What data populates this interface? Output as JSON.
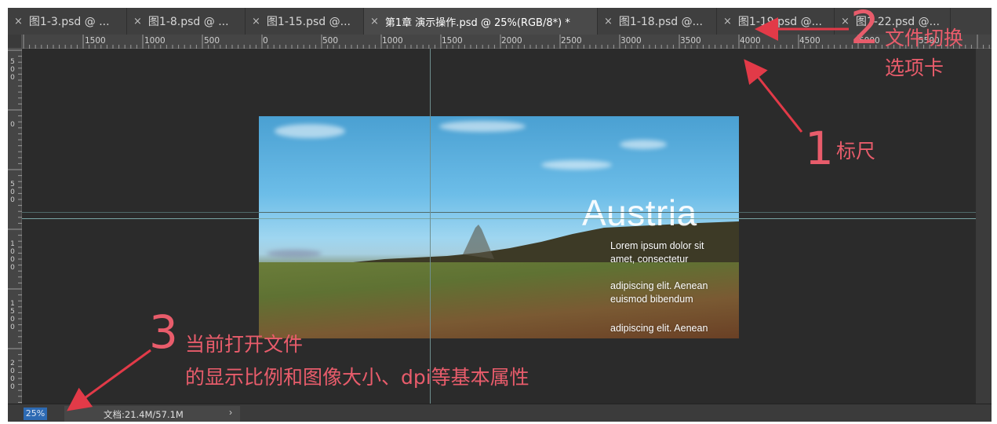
{
  "tabs": [
    {
      "label": "图1-3.psd @ ..."
    },
    {
      "label": "图1-8.psd @ ..."
    },
    {
      "label": "图1-15.psd @..."
    },
    {
      "label": "第1章 演示操作.psd @ 25%(RGB/8*) *",
      "active": true
    },
    {
      "label": "图1-18.psd @..."
    },
    {
      "label": "图1-19.psd @..."
    },
    {
      "label": "图1-22.psd @..."
    }
  ],
  "tab_close_glyph": "×",
  "ruler": {
    "h_labels": [
      "1500",
      "1000",
      "500",
      "0",
      "500",
      "1000",
      "1500",
      "2000",
      "2500",
      "3000",
      "3500",
      "4000",
      "4500",
      "5000",
      "5500"
    ],
    "v_labels": [
      "500",
      "0",
      "500",
      "1000",
      "1500",
      "2000"
    ]
  },
  "image": {
    "title": "Austria",
    "para1_line1": "Lorem ipsum dolor sit",
    "para1_line2": "amet, consectetur",
    "para2_line1": "adipiscing elit. Aenean",
    "para2_line2": "euismod bibendum",
    "para3_line1": "adipiscing elit. Aenean"
  },
  "status": {
    "zoom": "25%",
    "doc_info": "文档:21.4M/57.1M",
    "more_glyph": "›"
  },
  "annotations": {
    "a1_num": "1",
    "a1_text": "标尺",
    "a2_num": "2",
    "a2_line1": "文件切换",
    "a2_line2": "选项卡",
    "a3_num": "3",
    "a3_line1": "当前打开文件",
    "a3_line2": "的显示比例和图像大小、dpi等基本属性"
  },
  "colors": {
    "annotation": "#e85c6b",
    "zoom_highlight": "#2d6ab3",
    "guide": "#7aa6a6"
  }
}
